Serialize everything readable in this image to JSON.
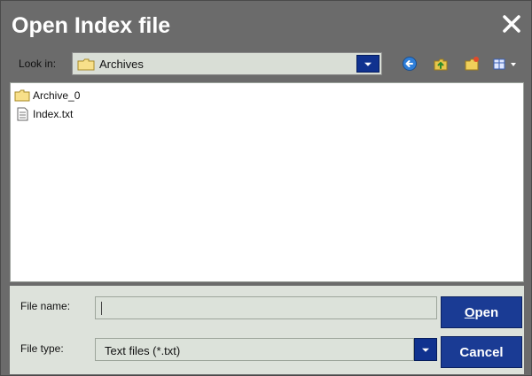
{
  "window": {
    "title": "Open Index file"
  },
  "toolbar": {
    "look_in_label": "Look in:",
    "look_in_value": "Archives",
    "tools": [
      {
        "icon": "back-icon"
      },
      {
        "icon": "up-folder-icon"
      },
      {
        "icon": "new-folder-icon"
      },
      {
        "icon": "view-menu-icon"
      }
    ]
  },
  "files": [
    {
      "name": "Archive_0",
      "icon": "folder-icon"
    },
    {
      "name": "Index.txt",
      "icon": "text-file-icon"
    }
  ],
  "form": {
    "file_name_label": "File name:",
    "file_name_value": "",
    "file_type_label": "File type:",
    "file_type_value": "Text files (*.txt)",
    "open_label": "Open",
    "cancel_label": "Cancel"
  },
  "colors": {
    "title_bar": "#6b6b6b",
    "button_blue": "#1a3b94",
    "panel": "#dde2db"
  }
}
